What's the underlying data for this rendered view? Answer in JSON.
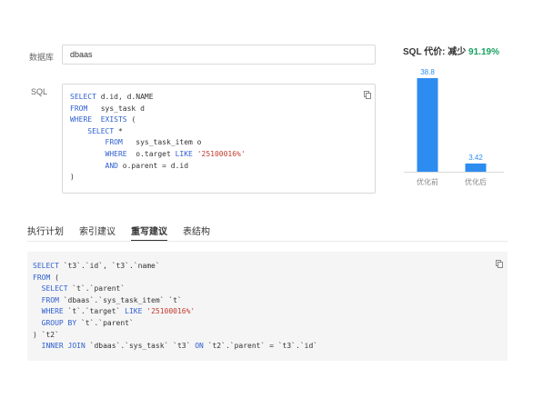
{
  "form": {
    "database_label": "数据库",
    "database_value": "dbaas",
    "sql_label": "SQL"
  },
  "sql_input": {
    "lines": [
      [
        {
          "t": "SELECT ",
          "c": "kw"
        },
        {
          "t": "d.id, d.NAME",
          "c": "plain"
        }
      ],
      [
        {
          "t": "FROM   ",
          "c": "kw"
        },
        {
          "t": "sys_task d",
          "c": "plain"
        }
      ],
      [
        {
          "t": "WHERE  EXISTS ",
          "c": "kw"
        },
        {
          "t": "(",
          "c": "plain"
        }
      ],
      [
        {
          "t": "    SELECT ",
          "c": "kw"
        },
        {
          "t": "*",
          "c": "plain"
        }
      ],
      [
        {
          "t": "        FROM   ",
          "c": "kw"
        },
        {
          "t": "sys_task_item o",
          "c": "plain"
        }
      ],
      [
        {
          "t": "        WHERE  ",
          "c": "kw"
        },
        {
          "t": "o.target ",
          "c": "plain"
        },
        {
          "t": "LIKE ",
          "c": "kw"
        },
        {
          "t": "'25100016%'",
          "c": "str"
        }
      ],
      [
        {
          "t": "        AND ",
          "c": "kw"
        },
        {
          "t": "o.parent = d.id",
          "c": "plain"
        }
      ],
      [
        {
          "t": ")",
          "c": "plain"
        }
      ]
    ]
  },
  "cost": {
    "title_prefix": "SQL 代价: 减少 ",
    "percent": "91.19%"
  },
  "chart_data": {
    "type": "bar",
    "categories": [
      "优化前",
      "优化后"
    ],
    "values": [
      38.8,
      3.42
    ],
    "value_labels": [
      "38.8",
      "3.42"
    ],
    "ylim": [
      0,
      38.8
    ],
    "bar_color": "#2d8cf0"
  },
  "tabs": [
    {
      "label": "执行计划",
      "active": false
    },
    {
      "label": "索引建议",
      "active": false
    },
    {
      "label": "重写建议",
      "active": true
    },
    {
      "label": "表结构",
      "active": false
    }
  ],
  "rewrite": {
    "lines": [
      [
        {
          "t": "SELECT ",
          "c": "kw"
        },
        {
          "t": "`t3`.`id`, `t3`.`name`",
          "c": "plain"
        }
      ],
      [
        {
          "t": "FROM ",
          "c": "kw"
        },
        {
          "t": "(",
          "c": "plain"
        }
      ],
      [
        {
          "t": "  SELECT ",
          "c": "kw"
        },
        {
          "t": "`t`.`parent`",
          "c": "plain"
        }
      ],
      [
        {
          "t": "  FROM ",
          "c": "kw"
        },
        {
          "t": "`dbaas`.`sys_task_item` `t`",
          "c": "plain"
        }
      ],
      [
        {
          "t": "  WHERE ",
          "c": "kw"
        },
        {
          "t": "`t`.`target` ",
          "c": "plain"
        },
        {
          "t": "LIKE ",
          "c": "kw"
        },
        {
          "t": "'25100016%'",
          "c": "str"
        }
      ],
      [
        {
          "t": "  GROUP BY ",
          "c": "kw"
        },
        {
          "t": "`t`.`parent`",
          "c": "plain"
        }
      ],
      [
        {
          "t": ") `t2`",
          "c": "plain"
        }
      ],
      [
        {
          "t": "  INNER JOIN ",
          "c": "kw"
        },
        {
          "t": "`dbaas`.`sys_task` `t3` ",
          "c": "plain"
        },
        {
          "t": "ON ",
          "c": "kw"
        },
        {
          "t": "`t2`.`parent` = `t3`.`id`",
          "c": "plain"
        }
      ]
    ]
  }
}
